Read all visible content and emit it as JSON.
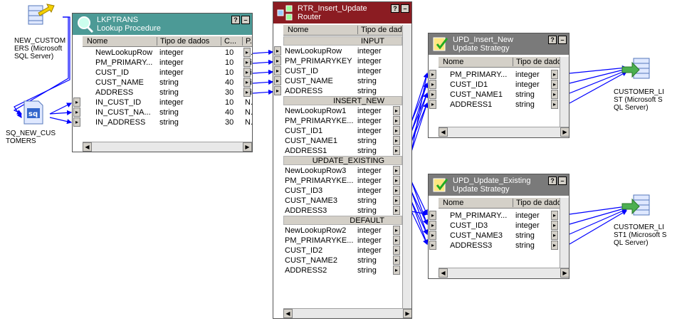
{
  "sources": {
    "new_customers": "NEW_CUSTOM\nERS (Microsoft\nSQL Server)",
    "sq_new_customers": "SQ_NEW_CUS\nTOMERS",
    "customer_list": "CUSTOMER_LI\nST (Microsoft S\nQL Server)",
    "customer_list1": "CUSTOMER_LI\nST1 (Microsoft S\nQL Server)"
  },
  "lookup": {
    "name": "LKPTRANS",
    "type": "Lookup Procedure",
    "col_name": "Nome",
    "col_type": "Tipo de dados",
    "col_c": "C...",
    "col_p": "P...",
    "rows": [
      {
        "name": "NewLookupRow",
        "type": "integer",
        "c": "10",
        "p": "N..."
      },
      {
        "name": "PM_PRIMARY...",
        "type": "integer",
        "c": "10",
        "p": "Sim"
      },
      {
        "name": "CUST_ID",
        "type": "integer",
        "c": "10",
        "p": "Sim"
      },
      {
        "name": "CUST_NAME",
        "type": "string",
        "c": "40",
        "p": "Sim"
      },
      {
        "name": "ADDRESS",
        "type": "string",
        "c": "30",
        "p": "Sim"
      },
      {
        "name": "IN_CUST_ID",
        "type": "integer",
        "c": "10",
        "p": "N..."
      },
      {
        "name": "IN_CUST_NA...",
        "type": "string",
        "c": "40",
        "p": "N..."
      },
      {
        "name": "IN_ADDRESS",
        "type": "string",
        "c": "30",
        "p": "N..."
      }
    ]
  },
  "router": {
    "name": "RTR_Insert_Update",
    "type": "Router",
    "col_name": "Nome",
    "col_type": "Tipo de dado",
    "groups": [
      {
        "label": "INPUT",
        "rows": [
          {
            "name": "NewLookupRow",
            "type": "integer"
          },
          {
            "name": "PM_PRIMARYKEY",
            "type": "integer"
          },
          {
            "name": "CUST_ID",
            "type": "integer"
          },
          {
            "name": "CUST_NAME",
            "type": "string"
          },
          {
            "name": "ADDRESS",
            "type": "string"
          }
        ]
      },
      {
        "label": "INSERT_NEW",
        "rows": [
          {
            "name": "NewLookupRow1",
            "type": "integer"
          },
          {
            "name": "PM_PRIMARYKE...",
            "type": "integer"
          },
          {
            "name": "CUST_ID1",
            "type": "integer"
          },
          {
            "name": "CUST_NAME1",
            "type": "string"
          },
          {
            "name": "ADDRESS1",
            "type": "string"
          }
        ]
      },
      {
        "label": "UPDATE_EXISTING",
        "rows": [
          {
            "name": "NewLookupRow3",
            "type": "integer"
          },
          {
            "name": "PM_PRIMARYKE...",
            "type": "integer"
          },
          {
            "name": "CUST_ID3",
            "type": "integer"
          },
          {
            "name": "CUST_NAME3",
            "type": "string"
          },
          {
            "name": "ADDRESS3",
            "type": "string"
          }
        ]
      },
      {
        "label": "DEFAULT",
        "rows": [
          {
            "name": "NewLookupRow2",
            "type": "integer"
          },
          {
            "name": "PM_PRIMARYKE...",
            "type": "integer"
          },
          {
            "name": "CUST_ID2",
            "type": "integer"
          },
          {
            "name": "CUST_NAME2",
            "type": "string"
          },
          {
            "name": "ADDRESS2",
            "type": "string"
          }
        ]
      }
    ]
  },
  "upd_insert": {
    "name": "UPD_Insert_New",
    "type": "Update Strategy",
    "col_name": "Nome",
    "col_type": "Tipo de dado",
    "rows": [
      {
        "name": "PM_PRIMARY...",
        "type": "integer"
      },
      {
        "name": "CUST_ID1",
        "type": "integer"
      },
      {
        "name": "CUST_NAME1",
        "type": "string"
      },
      {
        "name": "ADDRESS1",
        "type": "string"
      }
    ]
  },
  "upd_update": {
    "name": "UPD_Update_Existing",
    "type": "Update Strategy",
    "col_name": "Nome",
    "col_type": "Tipo de dado",
    "rows": [
      {
        "name": "PM_PRIMARY...",
        "type": "integer"
      },
      {
        "name": "CUST_ID3",
        "type": "integer"
      },
      {
        "name": "CUST_NAME3",
        "type": "string"
      },
      {
        "name": "ADDRESS3",
        "type": "string"
      }
    ]
  },
  "window_buttons": {
    "help": "?",
    "minimize": "–"
  },
  "colors": {
    "link": "#0000ff",
    "lookup_header": "#4c9a96",
    "router_header": "#8b1c22",
    "update_header": "#7a7a7a"
  }
}
